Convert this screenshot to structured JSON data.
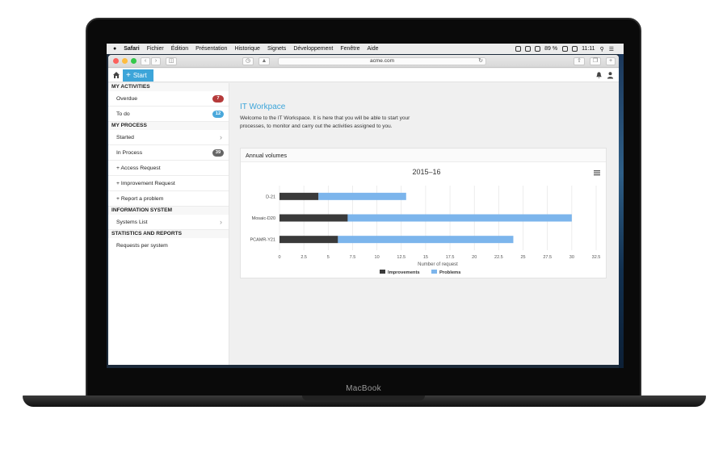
{
  "menubar": {
    "items": [
      "Safari",
      "Fichier",
      "Édition",
      "Présentation",
      "Historique",
      "Signets",
      "Développement",
      "Fenêtre",
      "Aide"
    ],
    "battery": "89 %",
    "clock": "11:11"
  },
  "browser": {
    "url": "acme.com"
  },
  "app": {
    "start_label": "Start",
    "sidebar": {
      "sec_activities": "MY ACTIVITIES",
      "overdue": "Overdue",
      "overdue_count": "7",
      "todo": "To do",
      "todo_count": "12",
      "sec_process": "MY PROCESS",
      "started": "Started",
      "in_process": "In Process",
      "in_process_count": "39",
      "access_request": "+ Access Request",
      "improvement_request": "+ Improvement Request",
      "report_problem": "+ Report a problem",
      "sec_info": "INFORMATION SYSTEM",
      "systems_list": "Systems List",
      "sec_stats": "STATISTICS AND REPORTS",
      "requests_per_system": "Requests per system"
    },
    "main": {
      "title": "IT Workpace",
      "intro": "Welcome to the IT Workspace. It is here that you will be able to start your processes, to monitor and carry out the activities assigned to you.",
      "card_title": "Annual volumes"
    }
  },
  "colors": {
    "accent": "#3da5d9",
    "badge_red": "#b53a3a",
    "badge_blue": "#4aa8db",
    "badge_gray": "#666666",
    "improvements": "#3a3a3a",
    "problems": "#7cb5ec"
  },
  "chart_data": {
    "type": "bar",
    "orientation": "horizontal",
    "stacked": true,
    "title": "2015–16",
    "xlabel": "Number of request",
    "categories": [
      "D-21",
      "Mosaic-D20",
      "PCAMR-Y21"
    ],
    "series": [
      {
        "name": "Improvements",
        "values": [
          4,
          7,
          6
        ]
      },
      {
        "name": "Problems",
        "values": [
          9,
          23,
          18
        ]
      }
    ],
    "xlim": [
      0,
      32.5
    ],
    "xticks": [
      "0",
      "2.5",
      "5",
      "7.5",
      "10",
      "12.5",
      "15",
      "17.5",
      "20",
      "22.5",
      "25",
      "27.5",
      "30",
      "32.5"
    ],
    "grid": true,
    "legend_position": "bottom"
  }
}
